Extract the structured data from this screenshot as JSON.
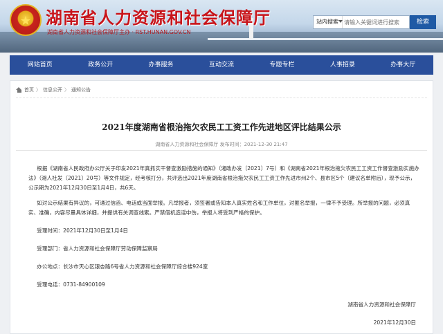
{
  "header": {
    "emblem_glyph": "★",
    "title": "湖南省人力资源和社会保障厅",
    "subtitle": "湖南省人力资源和社会保障厅主办 · RST.HUNAN.GOV.CN",
    "search_scope": "站内搜索",
    "search_placeholder": "请输入关键词进行搜索",
    "search_button": "检索"
  },
  "nav": {
    "items": [
      "网站首页",
      "政务公开",
      "办事服务",
      "互动交流",
      "专题专栏",
      "人事招录",
      "办事大厅"
    ]
  },
  "breadcrumb": {
    "items": [
      "首页",
      "信息公开",
      "通知公告"
    ],
    "separator": "〉"
  },
  "article": {
    "title": "2021年度湖南省根治拖欠农民工工资工作先进地区评比结果公示",
    "meta": "湖南省人力资源和社会保障厅  发布时间：2021-12-30 21:47",
    "para1": "根据《湖南省人民政府办公厅关于印发2021年真抓实干督查激励措施的通知》（湘政办发〔2021〕7号）和《湖南省2021年根治拖欠农民工工资工作督查激励实施办法》（湘人社发〔2021〕20号）等文件规定，经考核打分，共评选出2021年度湖南省根治拖欠农民工工资工作先进市州2个、县市区5个（建议名单附后），现予公示，公示期为2021年12月30日至1月4日，共6天。",
    "para2": "如对公示结果有异议的，可通过信函、电话或当面举报。凡举报者，须签署或告知本人真实姓名和工作单位，对匿名举报，一律不予受理。所举报的问题，必须真实、准确，内容尽量具体详细，并提供有关调查线索。严禁借机造谣中伤，举报人将受到严格的保护。",
    "time": "受理时间：2021年12月30日至1月4日",
    "dept": "受理部门：省人力资源和社会保障厅劳动保障监察局",
    "address": "办公地点：长沙市天心区银杏路6号省人力资源和社会保障厅综合楼924室",
    "phone": "受理电话：0731-84900109",
    "signature": "湖南省人力资源和社会保障厅",
    "date": "2021年12月30日"
  }
}
